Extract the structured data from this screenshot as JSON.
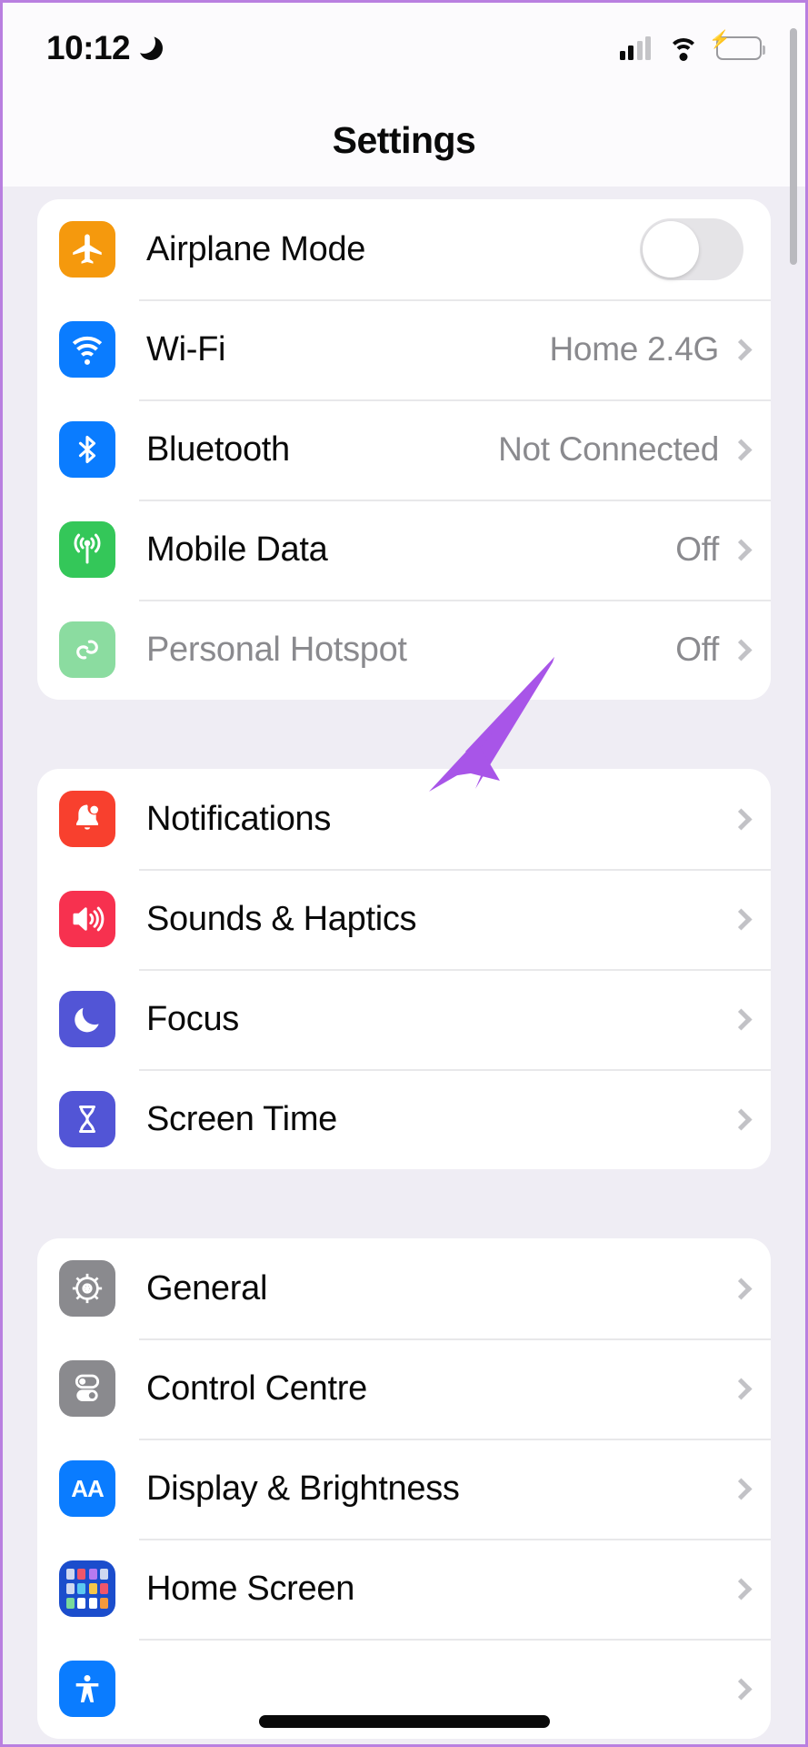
{
  "status_bar": {
    "time": "10:12",
    "dnd_icon": "crescent-moon-icon",
    "signal_icon": "cellular-bars-icon",
    "wifi_icon": "wifi-icon",
    "battery_icon": "battery-charging-icon",
    "battery_bolt": "⚡",
    "battery_color": "#34C759"
  },
  "navbar": {
    "title": "Settings"
  },
  "groups": [
    {
      "name": "connectivity-group",
      "rows": [
        {
          "label": "Airplane Mode",
          "icon": "airplane-icon",
          "icon_color": "#F5990D",
          "control": "toggle",
          "toggle_state": "off",
          "value": "",
          "disabled": false
        },
        {
          "label": "Wi-Fi",
          "icon": "wifi-icon",
          "icon_color": "#0A7CFF",
          "control": "chevron",
          "value": "Home 2.4G",
          "disabled": false
        },
        {
          "label": "Bluetooth",
          "icon": "bluetooth-icon",
          "icon_color": "#0A7CFF",
          "control": "chevron",
          "value": "Not Connected",
          "disabled": false
        },
        {
          "label": "Mobile Data",
          "icon": "cellular-antenna-icon",
          "icon_color": "#34C759",
          "control": "chevron",
          "value": "Off",
          "disabled": false
        },
        {
          "label": "Personal Hotspot",
          "icon": "hotspot-link-icon",
          "icon_color": "#8BDCA0",
          "control": "chevron",
          "value": "Off",
          "disabled": true
        }
      ]
    },
    {
      "name": "notifications-group",
      "rows": [
        {
          "label": "Notifications",
          "icon": "bell-icon",
          "icon_color": "#F8402E",
          "control": "chevron",
          "value": "",
          "disabled": false
        },
        {
          "label": "Sounds & Haptics",
          "icon": "speaker-waves-icon",
          "icon_color": "#F7314F",
          "control": "chevron",
          "value": "",
          "disabled": false
        },
        {
          "label": "Focus",
          "icon": "crescent-moon-icon",
          "icon_color": "#5255D6",
          "control": "chevron",
          "value": "",
          "disabled": false
        },
        {
          "label": "Screen Time",
          "icon": "hourglass-icon",
          "icon_color": "#5255D6",
          "control": "chevron",
          "value": "",
          "disabled": false
        }
      ]
    },
    {
      "name": "system-group",
      "rows": [
        {
          "label": "General",
          "icon": "gear-icon",
          "icon_color": "#8A8A8E",
          "control": "chevron",
          "value": "",
          "disabled": false
        },
        {
          "label": "Control Centre",
          "icon": "toggles-icon",
          "icon_color": "#8A8A8E",
          "control": "chevron",
          "value": "",
          "disabled": false
        },
        {
          "label": "Display & Brightness",
          "icon": "text-size-aa-icon",
          "icon_color": "#0A7CFF",
          "control": "chevron",
          "value": "",
          "disabled": false
        },
        {
          "label": "Home Screen",
          "icon": "app-grid-icon",
          "icon_color": "#1B4DCC",
          "control": "chevron",
          "value": "",
          "disabled": false
        }
      ]
    }
  ],
  "annotation": {
    "type": "arrow",
    "color": "#A855E8",
    "points_to": "Sounds & Haptics"
  },
  "scrollbar": {
    "name": "vertical-scrollbar"
  },
  "home_indicator": {
    "name": "home-indicator"
  }
}
